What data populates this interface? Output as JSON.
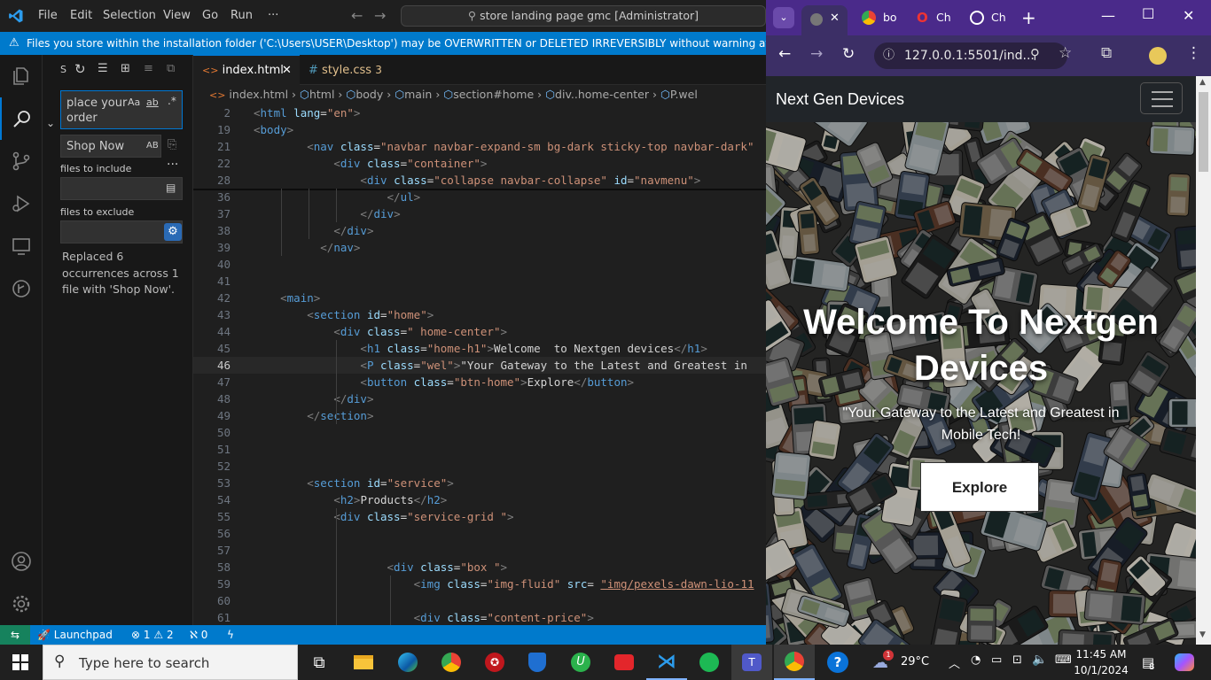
{
  "vscode": {
    "menu": [
      "File",
      "Edit",
      "Selection",
      "View",
      "Go",
      "Run"
    ],
    "more": "···",
    "search_title": "store landing page gmc [Administrator]",
    "warning": "Files you store within the installation folder ('C:\\Users\\USER\\Desktop') may be OVERWRITTEN or DELETED IRREVERSIBLY without warning at update time.",
    "sidebar": {
      "header_letter": "S",
      "search_value": "place your order",
      "replace_value": "Shop Now",
      "files_include_label": "files to include",
      "files_exclude_label": "files to exclude",
      "result_text": "Replaced 6 occurrences across 1 file with 'Shop Now'.",
      "opt_case": "Aa",
      "opt_word": "ab",
      "opt_regex": ".*",
      "opt_preserve": "AB"
    },
    "tabs": [
      {
        "label": "index.html",
        "active": true
      },
      {
        "label": "style.css",
        "badge": "3",
        "active": false
      }
    ],
    "breadcrumb": [
      "index.html",
      "html",
      "body",
      "main",
      "section#home",
      "div..home-center",
      "P.wel"
    ],
    "sticky_lines": [
      {
        "n": "2",
        "html": "<span class='pu'>&lt;</span><span class='tg'>html</span> <span class='at'>lang</span>=<span class='st'>\"en\"</span><span class='pu'>&gt;</span>"
      },
      {
        "n": "19",
        "html": "<span class='pu'>&lt;</span><span class='tg'>body</span><span class='pu'>&gt;</span>"
      },
      {
        "n": "21",
        "html": "        <span class='pu'>&lt;</span><span class='tg'>nav</span> <span class='at'>class</span>=<span class='st'>\"navbar navbar-expand-sm bg-dark sticky-top navbar-dark\"</span>"
      },
      {
        "n": "22",
        "html": "            <span class='pu'>&lt;</span><span class='tg'>div</span> <span class='at'>class</span>=<span class='st'>\"container\"</span><span class='pu'>&gt;</span>"
      },
      {
        "n": "28",
        "html": "                <span class='pu'>&lt;</span><span class='tg'>div</span> <span class='at'>class</span>=<span class='st'>\"collapse navbar-collapse\"</span> <span class='at'>id</span>=<span class='st'>\"navmenu\"</span><span class='pu'>&gt;</span>"
      }
    ],
    "code_lines": [
      {
        "n": "36",
        "html": "                    <span class='pu'>&lt;/</span><span class='tg'>ul</span><span class='pu'>&gt;</span>"
      },
      {
        "n": "37",
        "html": "                <span class='pu'>&lt;/</span><span class='tg'>div</span><span class='pu'>&gt;</span>"
      },
      {
        "n": "38",
        "html": "            <span class='pu'>&lt;/</span><span class='tg'>div</span><span class='pu'>&gt;</span>"
      },
      {
        "n": "39",
        "html": "          <span class='pu'>&lt;/</span><span class='tg'>nav</span><span class='pu'>&gt;</span>"
      },
      {
        "n": "40",
        "html": ""
      },
      {
        "n": "41",
        "html": ""
      },
      {
        "n": "42",
        "html": "    <span class='pu'>&lt;</span><span class='tg'>main</span><span class='pu'>&gt;</span>"
      },
      {
        "n": "43",
        "html": "        <span class='pu'>&lt;</span><span class='tg'>section</span> <span class='at'>id</span>=<span class='st'>\"home\"</span><span class='pu'>&gt;</span>"
      },
      {
        "n": "44",
        "html": "            <span class='pu'>&lt;</span><span class='tg'>div</span> <span class='at'>class</span>=<span class='st'>\" home-center\"</span><span class='pu'>&gt;</span>"
      },
      {
        "n": "45",
        "html": "                <span class='pu'>&lt;</span><span class='tg'>h1</span> <span class='at'>class</span>=<span class='st'>\"home-h1\"</span><span class='pu'>&gt;</span>Welcome  to Nextgen devices<span class='pu'>&lt;/</span><span class='tg'>h1</span><span class='pu'>&gt;</span>"
      },
      {
        "n": "46",
        "html": "                <span class='pu'>&lt;</span><span class='tg'>P</span> <span class='at'>class</span>=<span class='st'>\"wel\"</span><span class='pu'>&gt;</span>\"Your Gateway to the Latest and Greatest in"
      },
      {
        "n": "47",
        "html": "                <span class='pu'>&lt;</span><span class='tg'>button</span> <span class='at'>class</span>=<span class='st'>\"btn-home\"</span><span class='pu'>&gt;</span>Explore<span class='pu'>&lt;/</span><span class='tg'>button</span><span class='pu'>&gt;</span>"
      },
      {
        "n": "48",
        "html": "            <span class='pu'>&lt;/</span><span class='tg'>div</span><span class='pu'>&gt;</span>"
      },
      {
        "n": "49",
        "html": "        <span class='pu'>&lt;/</span><span class='tg'>section</span><span class='pu'>&gt;</span>"
      },
      {
        "n": "50",
        "html": ""
      },
      {
        "n": "51",
        "html": ""
      },
      {
        "n": "52",
        "html": ""
      },
      {
        "n": "53",
        "html": "        <span class='pu'>&lt;</span><span class='tg'>section</span> <span class='at'>id</span>=<span class='st'>\"service\"</span><span class='pu'>&gt;</span>"
      },
      {
        "n": "54",
        "html": "            <span class='pu'>&lt;</span><span class='tg'>h2</span><span class='pu'>&gt;</span>Products<span class='pu'>&lt;/</span><span class='tg'>h2</span><span class='pu'>&gt;</span>"
      },
      {
        "n": "55",
        "html": "            <span class='pu'>&lt;</span><span class='tg'>div</span> <span class='at'>class</span>=<span class='st'>\"service-grid \"</span><span class='pu'>&gt;</span>"
      },
      {
        "n": "56",
        "html": ""
      },
      {
        "n": "57",
        "html": ""
      },
      {
        "n": "58",
        "html": "                    <span class='pu'>&lt;</span><span class='tg'>div</span> <span class='at'>class</span>=<span class='st'>\"box \"</span><span class='pu'>&gt;</span>"
      },
      {
        "n": "59",
        "html": "                        <span class='pu'>&lt;</span><span class='tg'>img</span> <span class='at'>class</span>=<span class='st'>\"img-fluid\"</span> <span class='at'>src</span>= <span class='st'><u>\"img/pexels-dawn-lio-11</u></span>"
      },
      {
        "n": "60",
        "html": ""
      },
      {
        "n": "61",
        "html": "                        <span class='pu'>&lt;</span><span class='tg'>div</span> <span class='at'>class</span>=<span class='st'>\"content-price\"</span><span class='pu'>&gt;</span>"
      }
    ],
    "current_line": "46",
    "status": {
      "launchpad": "Launchpad",
      "errors": "1",
      "warnings": "2",
      "ports": "0"
    }
  },
  "browser": {
    "tabs": [
      "bo",
      "Ch",
      "Ch"
    ],
    "url": "127.0.0.1:5501/ind...",
    "site": {
      "brand": "Next Gen Devices",
      "hero_title": "Welcome To Nextgen Devices",
      "hero_subtitle": "\"Your Gateway to the Latest and Greatest in Mobile Tech!",
      "button": "Explore"
    }
  },
  "taskbar": {
    "search_placeholder": "Type here to search",
    "weather": "29°C",
    "time": "11:45 AM",
    "date": "10/1/2024",
    "notifications": "8",
    "weather_badge": "1"
  },
  "colors": {
    "vscode_blue": "#007acc",
    "browser_purple": "#4a2a8a",
    "tag_blue": "#569cd6",
    "attr_cyan": "#9cdcfe",
    "string_orange": "#ce9178"
  }
}
